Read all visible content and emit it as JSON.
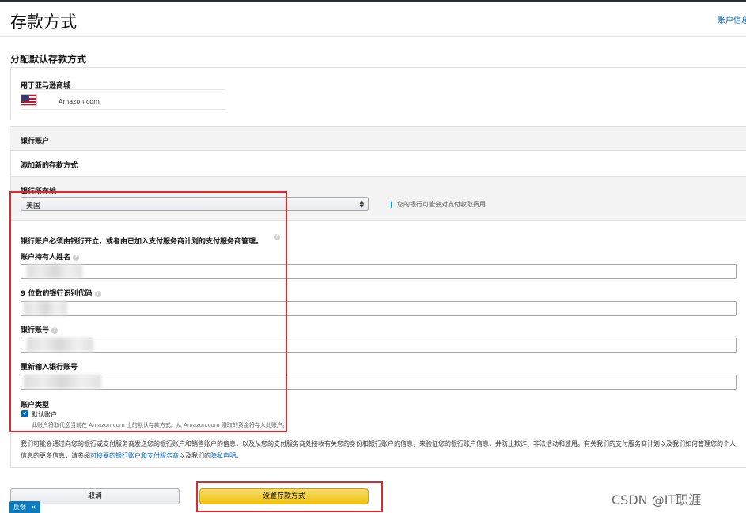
{
  "page": {
    "title": "存款方式",
    "top_link": "账户信息"
  },
  "default_section": {
    "heading": "分配默认存款方式",
    "market_label": "用于亚马逊商城",
    "market_name": "Amazon.com"
  },
  "bank_account": {
    "header": "银行账户",
    "add_new": "添加新的存款方式",
    "location_label": "银行所在地",
    "country_value": "美国",
    "fee_note": "您的银行可能会对支付收取费用",
    "requirement_text": "银行账户必须由银行开立，或者由已加入支付服务商计划的支付服务商管理。",
    "fields": [
      {
        "label": "账户持有人姓名",
        "value": ""
      },
      {
        "label": "9 位数的银行识别代码",
        "value": ""
      },
      {
        "label": "银行账号",
        "value": ""
      },
      {
        "label": "重新输入银行账号",
        "value": ""
      }
    ],
    "account_type_label": "账户类型",
    "default_checkbox_label": "默认账户",
    "default_checked": true,
    "default_note": "此账户将取代您当前在 Amazon.com 上的默认存款方式。从 Amazon.com 赚取的资金将存入此账户。"
  },
  "disclaimer": {
    "text_1": "我们可能会通过向您的银行或支付服务商发送您的银行账户和销售账户的信息，以及从您的支付服务商处接收有关您的身份和银行账户的信息，来验证您的银行账户信息，并防止欺诈、非法活动和滥用。有关我们的支付服务商计划以及我们如何管理您的个人信息的更多信息，请参阅",
    "link_1": "可接受的银行账户和支付服务商",
    "text_2": "以及我们的",
    "link_2": "隐私声明",
    "text_3": "。"
  },
  "buttons": {
    "cancel": "取消",
    "submit": "设置存款方式"
  },
  "feedback": {
    "label": "反馈",
    "close": "×"
  },
  "icons": {
    "help": "help-circle-icon",
    "select_arrows": "updown-chevron-icon",
    "checkbox": "checkmark-icon",
    "flag": "us-flag-icon",
    "close": "close-icon"
  },
  "watermark": "CSDN @IT职涯",
  "colors": {
    "accent_link": "#0066c0",
    "primary_button": "#f0c30e",
    "highlight": "#e0292b",
    "feedback_tab": "#0a7bbf"
  }
}
